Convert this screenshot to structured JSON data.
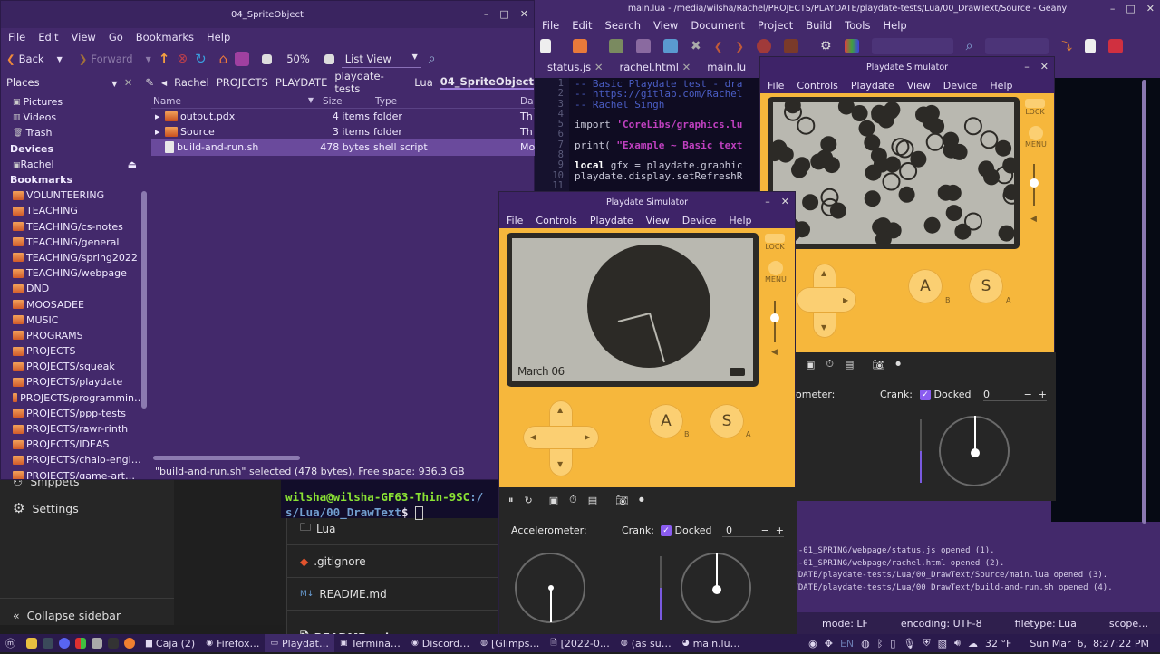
{
  "background_app": {
    "sidebar": {
      "items": [
        {
          "label": "Snippets",
          "icon": "snippets-icon"
        },
        {
          "label": "Settings",
          "icon": "gear-icon"
        }
      ],
      "collapse_label": "Collapse sidebar"
    },
    "repo_files": [
      {
        "name": "Lua",
        "icon": "folder-icon"
      },
      {
        "name": ".gitignore",
        "icon": "git-icon"
      },
      {
        "name": "README.md",
        "icon": "markdown-icon"
      }
    ],
    "readme_header": "README.md"
  },
  "caja": {
    "title": "04_SpriteObject",
    "menu": [
      "File",
      "Edit",
      "View",
      "Go",
      "Bookmarks",
      "Help"
    ],
    "toolbar": {
      "back": "Back",
      "forward": "Forward",
      "zoom": "50%",
      "view_mode": "List View"
    },
    "places_label": "Places",
    "path": [
      "Rachel",
      "PROJECTS",
      "PLAYDATE",
      "playdate-tests",
      "Lua",
      "04_SpriteObject"
    ],
    "places": {
      "top": [
        "Pictures",
        "Videos",
        "Trash"
      ],
      "devices_heading": "Devices",
      "devices": [
        "Rachel"
      ],
      "bookmarks_heading": "Bookmarks",
      "bookmarks": [
        "VOLUNTEERING",
        "TEACHING",
        "TEACHING/cs-notes",
        "TEACHING/general",
        "TEACHING/spring2022",
        "TEACHING/webpage",
        "DND",
        "MOOSADEE",
        "MUSIC",
        "PROGRAMS",
        "PROJECTS",
        "PROJECTS/squeak",
        "PROJECTS/playdate",
        "PROJECTS/programmin…",
        "PROJECTS/ppp-tests",
        "PROJECTS/rawr-rinth",
        "PROJECTS/IDEAS",
        "PROJECTS/chalo-engi…",
        "PROJECTS/game-art…"
      ]
    },
    "columns": [
      "Name",
      "Size",
      "Type",
      "Da"
    ],
    "files": [
      {
        "name": "output.pdx",
        "size": "4 items",
        "type": "folder",
        "date": "Th",
        "kind": "folder"
      },
      {
        "name": "Source",
        "size": "3 items",
        "type": "folder",
        "date": "Th",
        "kind": "folder"
      },
      {
        "name": "build-and-run.sh",
        "size": "478 bytes",
        "type": "shell script",
        "date": "Mo",
        "kind": "file",
        "selected": true
      }
    ],
    "status": "\"build-and-run.sh\" selected (478 bytes), Free space: 936.3 GB"
  },
  "geany": {
    "title": "main.lua - /media/wilsha/Rachel/PROJECTS/PLAYDATE/playdate-tests/Lua/00_DrawText/Source - Geany",
    "menu": [
      "File",
      "Edit",
      "Search",
      "View",
      "Document",
      "Project",
      "Build",
      "Tools",
      "Help"
    ],
    "tabs": [
      "status.js",
      "rachel.html",
      "main.lu"
    ],
    "line_numbers": [
      "1",
      "2",
      "3",
      "4",
      "5",
      "6",
      "7",
      "8",
      "9",
      "10",
      "11"
    ],
    "code": [
      {
        "parts": [
          {
            "t": "-- Basic Playdate test - dra",
            "c": "cm"
          }
        ]
      },
      {
        "parts": [
          {
            "t": "-- https://gitlab.com/Rachel",
            "c": "cm"
          }
        ]
      },
      {
        "parts": [
          {
            "t": "-- Rachel Singh",
            "c": "cm"
          }
        ]
      },
      {
        "parts": []
      },
      {
        "parts": [
          {
            "t": "import ",
            "c": ""
          },
          {
            "t": "'CoreLibs/graphics.lu",
            "c": "str"
          }
        ]
      },
      {
        "parts": []
      },
      {
        "parts": [
          {
            "t": "print( ",
            "c": ""
          },
          {
            "t": "\"Example ~ Basic text",
            "c": "str"
          }
        ]
      },
      {
        "parts": []
      },
      {
        "parts": [
          {
            "t": "local",
            "c": "kw"
          },
          {
            "t": " gfx = playdate.graphic",
            "c": ""
          }
        ]
      },
      {
        "parts": [
          {
            "t": "playdate.display.setRefreshR",
            "c": ""
          }
        ]
      },
      {
        "parts": []
      }
    ],
    "messages": [
      "22-01_SPRING/webpage/status.js opened (1).",
      "22-01_SPRING/webpage/rachel.html opened (2).",
      "AYDATE/playdate-tests/Lua/00_DrawText/Source/main.lua opened (3).",
      "AYDATE/playdate-tests/Lua/00_DrawText/build-and-run.sh opened (4)."
    ],
    "status": {
      "mode": "mode: LF",
      "encoding": "encoding: UTF-8",
      "filetype": "filetype: Lua",
      "scope": "scope…"
    }
  },
  "terminal": {
    "prompt_user": "wilsha@wilsha-GF63-Thin-9SC",
    "prompt_sep": ":/",
    "prompt_path": "s/Lua/00_DrawText",
    "prompt_end": "$ "
  },
  "sim_back": {
    "title": "Playdate Simulator",
    "menu": [
      "File",
      "Controls",
      "Playdate",
      "View",
      "Device",
      "Help"
    ],
    "lock": "LOCK",
    "menu_btn": "MENU",
    "a_label": "A",
    "a_sub": "B",
    "s_label": "S",
    "s_sub": "A",
    "accelerometer": "Accelerometer:",
    "crank": "Crank:",
    "docked": "Docked",
    "crank_value": "0"
  },
  "sim_front": {
    "title": "Playdate Simulator",
    "menu": [
      "File",
      "Controls",
      "Playdate",
      "View",
      "Device",
      "Help"
    ],
    "date": "March 06",
    "lock": "LOCK",
    "menu_btn": "MENU",
    "a_label": "A",
    "a_sub": "B",
    "s_label": "S",
    "s_sub": "A",
    "accelerometer": "Accelerometer:",
    "crank": "Crank:",
    "docked": "Docked",
    "crank_value": "0",
    "minus": "−",
    "plus": "+"
  },
  "taskbar": {
    "tasks": [
      "Caja (2)",
      "Firefox…",
      "Playdat…",
      "Termina…",
      "Discord…",
      "[Glimps…",
      "[2022-0…",
      "(as su…",
      "main.lu…"
    ],
    "active_task": "Playdat…",
    "tray": {
      "lang": "EN",
      "temp": "32 °F",
      "datetime": "Sun Mar  6,  8:27:22 PM"
    }
  }
}
